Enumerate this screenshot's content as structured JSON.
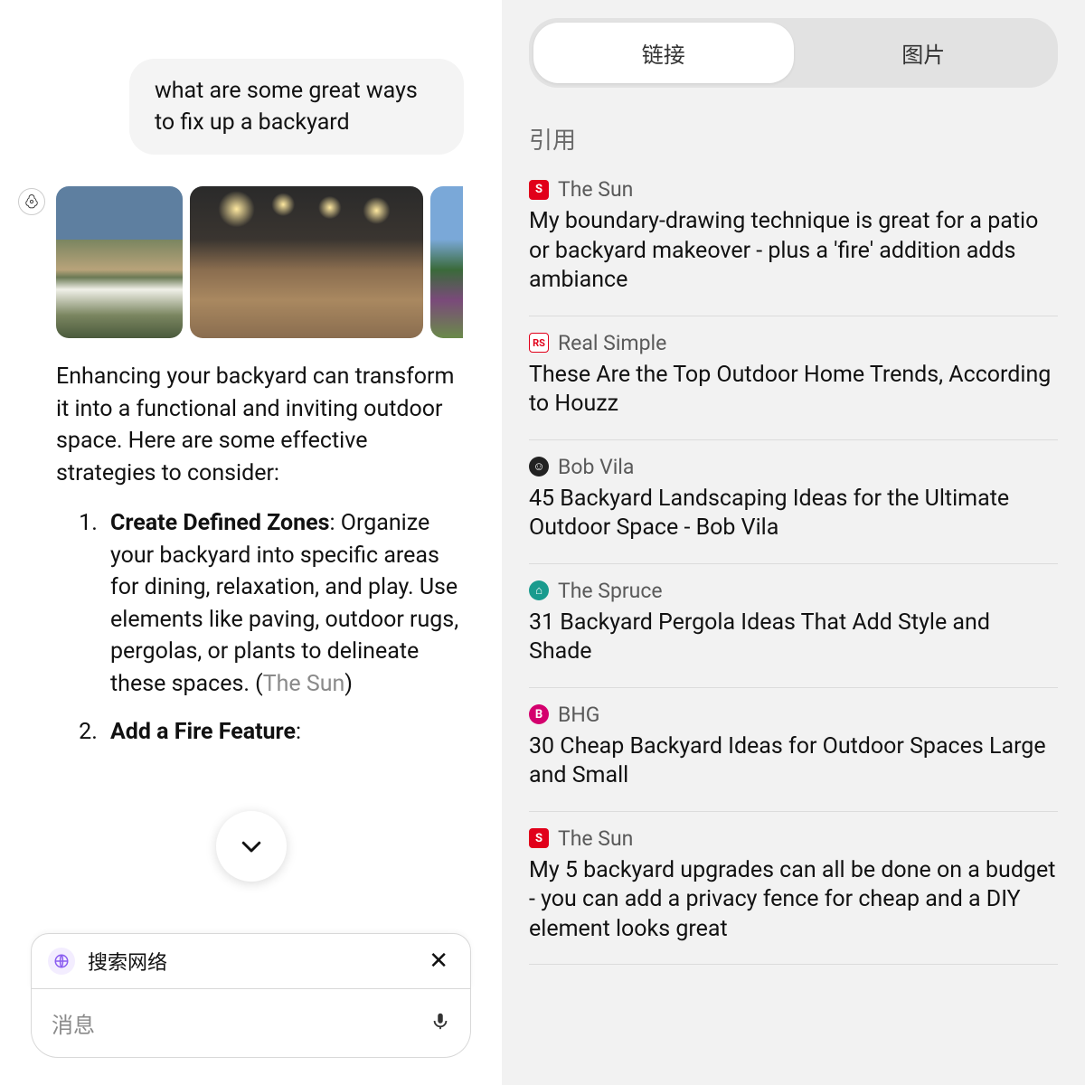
{
  "chat": {
    "user_message": "what are some great ways to fix up a backyard",
    "assistant_intro": "Enhancing your backyard can transform it into a functional and inviting outdoor space. Here are some effective strategies to consider:",
    "list": [
      {
        "title": "Create Defined Zones",
        "body": ": Organize your backyard into specific areas for dining, relaxation, and play. Use elements like paving, outdoor rugs, pergolas, or plants to delineate these spaces. (",
        "cite": "The Sun",
        "tail": ")"
      },
      {
        "title": "Add a Fire Feature",
        "body": ":",
        "cite": "",
        "tail": ""
      }
    ]
  },
  "scroll_down_label": "scroll-down",
  "search_chip": {
    "label": "搜索网络"
  },
  "message_input": {
    "placeholder": "消息"
  },
  "tabs": {
    "links": "链接",
    "images": "图片",
    "active": "links"
  },
  "citations_header": "引用",
  "citations": [
    {
      "source": "The Sun",
      "icon": "sun",
      "icon_text": "S",
      "title": "My boundary-drawing technique is great for a patio or backyard makeover - plus a 'fire' addition adds ambiance"
    },
    {
      "source": "Real Simple",
      "icon": "rs",
      "icon_text": "RS",
      "title": "These Are the Top Outdoor Home Trends, According to Houzz"
    },
    {
      "source": "Bob Vila",
      "icon": "bob",
      "icon_text": "☺",
      "title": "45 Backyard Landscaping Ideas for the Ultimate Outdoor Space - Bob Vila"
    },
    {
      "source": "The Spruce",
      "icon": "spruce",
      "icon_text": "⌂",
      "title": "31 Backyard Pergola Ideas That Add Style and Shade"
    },
    {
      "source": "BHG",
      "icon": "bhg",
      "icon_text": "B",
      "title": "30 Cheap Backyard Ideas for Outdoor Spaces Large and Small"
    },
    {
      "source": "The Sun",
      "icon": "sun",
      "icon_text": "S",
      "title": "My 5 backyard upgrades can all be done on a budget - you can add a privacy fence for cheap and a DIY element looks great"
    }
  ]
}
